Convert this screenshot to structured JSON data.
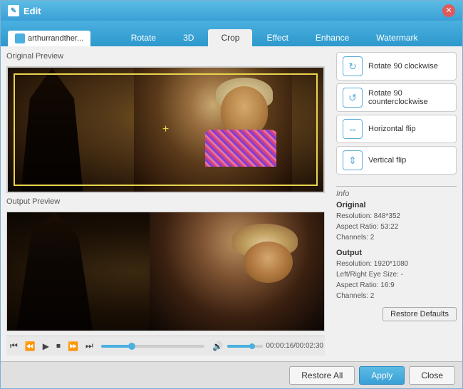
{
  "window": {
    "title": "Edit",
    "icon": "✎"
  },
  "file_tab": {
    "label": "arthurrandther..."
  },
  "tabs": [
    {
      "id": "rotate",
      "label": "Rotate",
      "active": false
    },
    {
      "id": "3d",
      "label": "3D",
      "active": false
    },
    {
      "id": "crop",
      "label": "Crop",
      "active": true
    },
    {
      "id": "effect",
      "label": "Effect",
      "active": false
    },
    {
      "id": "enhance",
      "label": "Enhance",
      "active": false
    },
    {
      "id": "watermark",
      "label": "Watermark",
      "active": false
    }
  ],
  "previews": {
    "original_label": "Original Preview",
    "output_label": "Output Preview"
  },
  "controls": {
    "time": "00:00:16/00:02:30"
  },
  "actions": [
    {
      "id": "rotate-cw",
      "label": "Rotate 90 clockwise",
      "icon": "↻"
    },
    {
      "id": "rotate-ccw",
      "label": "Rotate 90 counterclockwise",
      "icon": "↺"
    },
    {
      "id": "h-flip",
      "label": "Horizontal flip",
      "icon": "⇔"
    },
    {
      "id": "v-flip",
      "label": "Vertical flip",
      "icon": "⇕"
    }
  ],
  "info": {
    "section_label": "Info",
    "original": {
      "title": "Original",
      "resolution": "Resolution: 848*352",
      "aspect_ratio": "Aspect Ratio: 53:22",
      "channels": "Channels: 2"
    },
    "output": {
      "title": "Output",
      "resolution": "Resolution: 1920*1080",
      "left_right": "Left/Right Eye Size: -",
      "aspect_ratio": "Aspect Ratio: 16:9",
      "channels": "Channels: 2"
    }
  },
  "buttons": {
    "restore_defaults": "Restore Defaults",
    "restore_all": "Restore All",
    "apply": "Apply",
    "close": "Close"
  }
}
